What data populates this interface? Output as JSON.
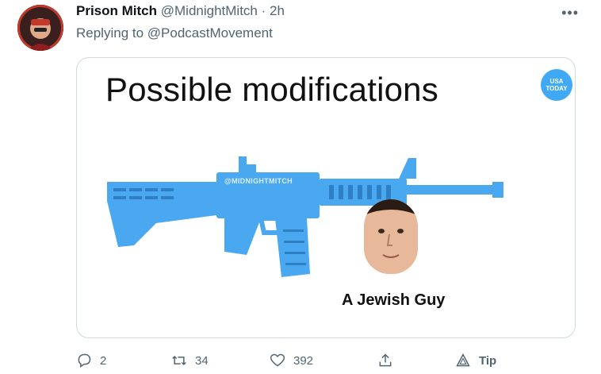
{
  "tweet": {
    "author_name": "Prison Mitch",
    "author_handle": "@MidnightMitch",
    "separator": "·",
    "time": "2h",
    "reply_prefix": "Replying to",
    "reply_to": "@PodcastMovement",
    "more_label": "•••"
  },
  "media": {
    "title": "Possible modifications",
    "badge_line1": "USA",
    "badge_line2": "TODAY",
    "watermark": "@MIDNIGHTMITCH",
    "caption": "A Jewish Guy",
    "accent_color": "#4aa8f0"
  },
  "actions": {
    "replies": "2",
    "retweets": "34",
    "likes": "392",
    "tip_label": "Tip"
  },
  "icons": {
    "reply": "reply-icon",
    "retweet": "retweet-icon",
    "like": "heart-icon",
    "share": "share-icon",
    "tip": "tip-icon"
  }
}
